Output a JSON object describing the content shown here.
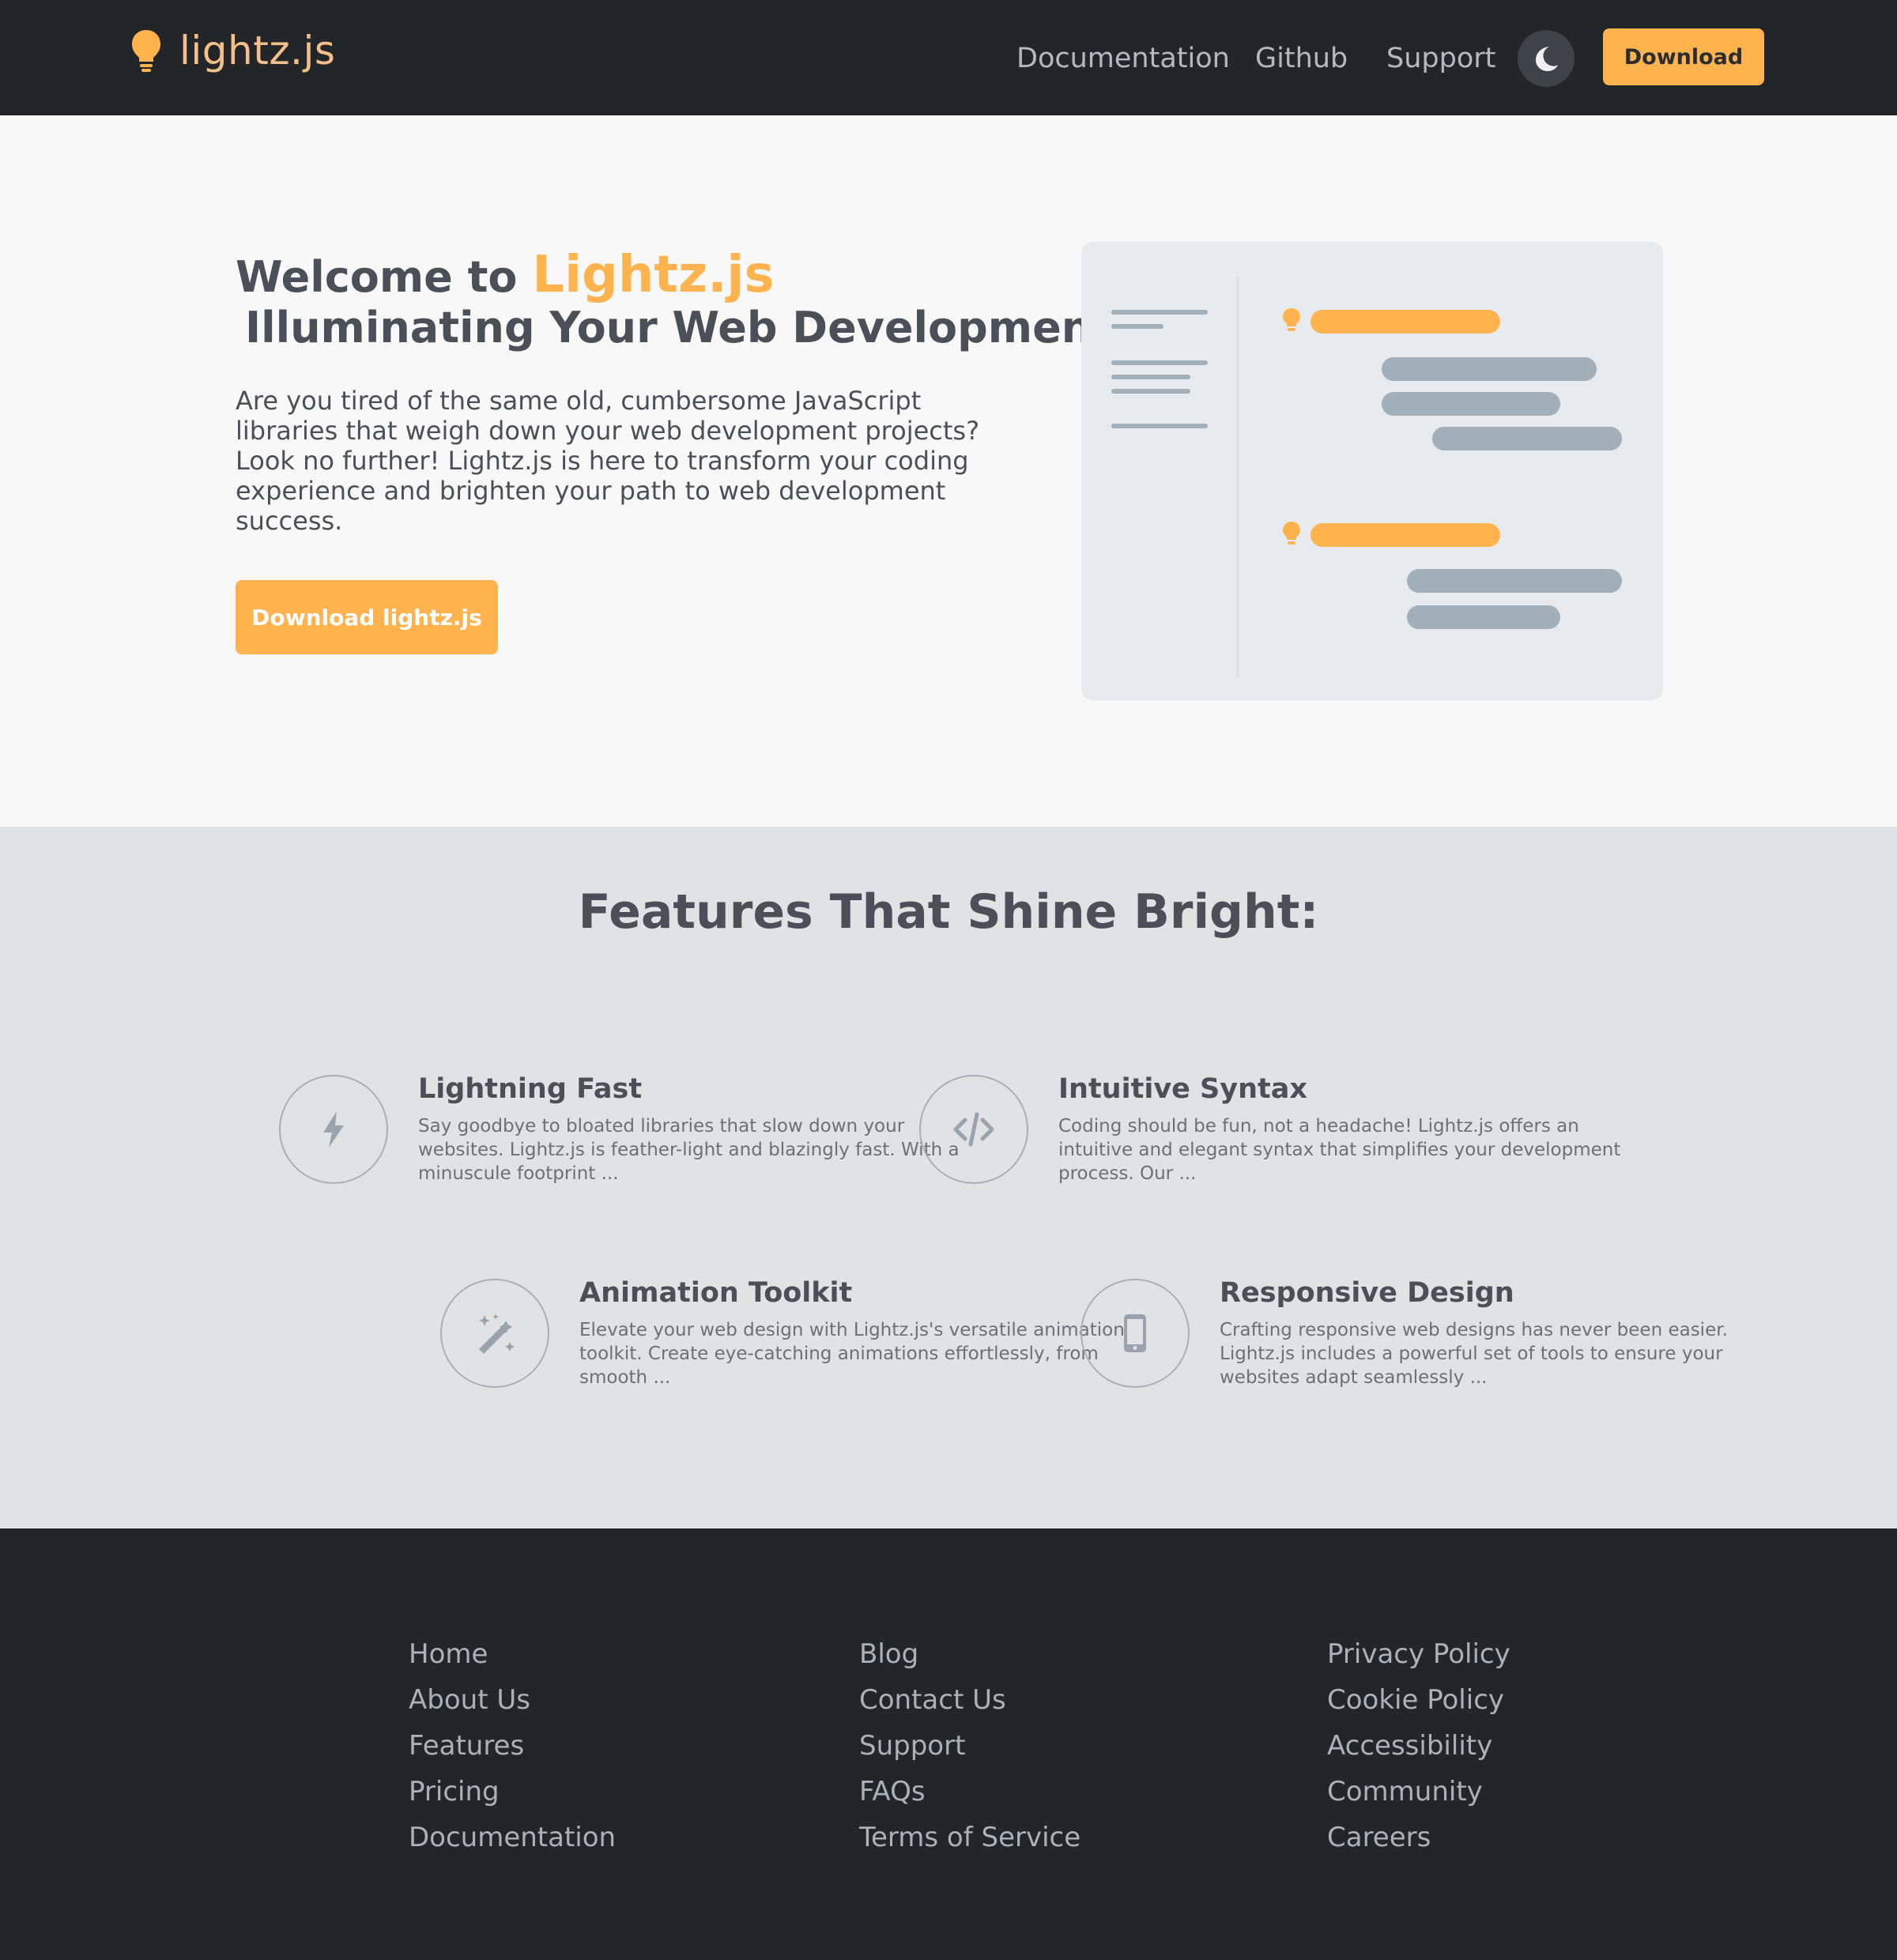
{
  "navbar": {
    "brand": "lightz.js",
    "links": [
      "Documentation",
      "Github",
      "Support"
    ],
    "theme_toggle_icon": "moon-icon",
    "download_label": "Download"
  },
  "hero": {
    "title_prefix": "Welcome to ",
    "title_brand": "Lightz.js",
    "title_line2": "Illuminating Your Web Development!",
    "description": "Are you tired of the same old, cumbersome JavaScript libraries that weigh down your web development projects? Look no further! Lightz.js is here to transform your coding experience and brighten your path to web development success.",
    "cta_label": "Download lightz.js"
  },
  "features": {
    "heading": "Features That Shine Bright:",
    "items": [
      {
        "icon": "lightning-icon",
        "title": "Lightning Fast",
        "description": "Say goodbye to bloated libraries that slow down your websites. Lightz.js is feather-light and blazingly fast. With a minuscule footprint ..."
      },
      {
        "icon": "code-icon",
        "title": "Intuitive Syntax",
        "description": "Coding should be fun, not a headache! Lightz.js offers an intuitive and elegant syntax that simplifies your development process. Our ..."
      },
      {
        "icon": "magic-wand-icon",
        "title": "Animation Toolkit",
        "description": "Elevate your web design with Lightz.js's versatile animation toolkit. Create eye-catching animations effortlessly, from smooth ..."
      },
      {
        "icon": "mobile-icon",
        "title": "Responsive Design",
        "description": "Crafting responsive web designs has never been easier. Lightz.js includes a powerful set of tools to ensure your websites adapt seamlessly ..."
      }
    ]
  },
  "footer": {
    "columns": [
      [
        "Home",
        "About Us",
        "Features",
        "Pricing",
        "Documentation"
      ],
      [
        "Blog",
        "Contact Us",
        "Support",
        "FAQs",
        "Terms of Service"
      ],
      [
        "Privacy Policy",
        "Cookie Policy",
        "Accessibility",
        "Community",
        "Careers"
      ]
    ]
  },
  "colors": {
    "accent": "#ffb34f",
    "dark": "#232629",
    "text": "#4b5058",
    "muted_bar": "#a2afb8"
  }
}
